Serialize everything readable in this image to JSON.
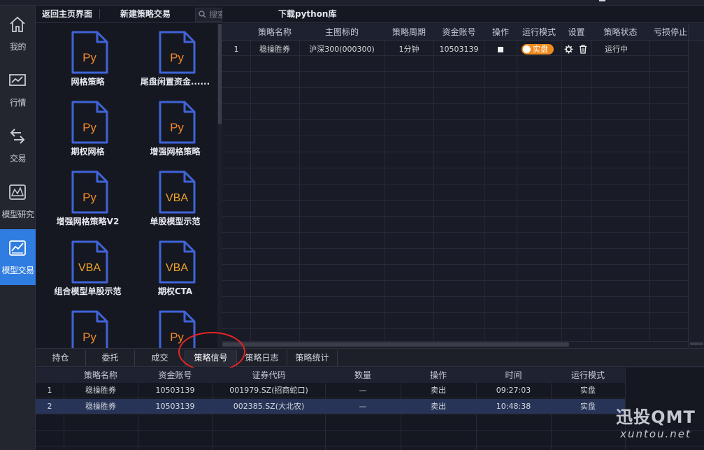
{
  "nav": {
    "items": [
      {
        "label": "我的",
        "icon": "home-icon"
      },
      {
        "label": "行情",
        "icon": "chart-icon"
      },
      {
        "label": "交易",
        "icon": "swap-icon"
      },
      {
        "label": "模型研究",
        "icon": "model-research-icon"
      },
      {
        "label": "模型交易",
        "icon": "model-trade-icon",
        "active": true
      }
    ]
  },
  "left_panel": {
    "back_label": "返回主页界面",
    "new_label": "新建策略交易",
    "search_placeholder": "搜索策略",
    "strategies": [
      {
        "name": "网格策略",
        "type": "Py"
      },
      {
        "name": "尾盘闲置资金......",
        "type": "Py"
      },
      {
        "name": "期权网格",
        "type": "Py"
      },
      {
        "name": "增强网格策略",
        "type": "Py"
      },
      {
        "name": "增强网格策略V2",
        "type": "Py"
      },
      {
        "name": "单股模型示范",
        "type": "VBA"
      },
      {
        "name": "组合模型单股示范",
        "type": "VBA"
      },
      {
        "name": "期权CTA",
        "type": "VBA"
      },
      {
        "name": "",
        "type": "Py"
      },
      {
        "name": "",
        "type": "Py"
      }
    ]
  },
  "python_tab": {
    "label": "下载python库"
  },
  "main_table": {
    "columns": [
      "",
      "策略名称",
      "主图标的",
      "策略周期",
      "资金账号",
      "操作",
      "运行模式",
      "设置",
      "策略状态",
      "亏损停止"
    ],
    "rows": [
      {
        "index": "1",
        "name": "稳操胜券",
        "symbol": "沪深300(000300)",
        "period": "1分钟",
        "account": "10503139",
        "mode": "实盘",
        "status": "运行中"
      }
    ]
  },
  "bottom_tabs": {
    "items": [
      "持仓",
      "委托",
      "成交",
      "策略信号",
      "策略日志",
      "策略统计"
    ],
    "active_index": 3
  },
  "signal_table": {
    "columns": [
      "",
      "策略名称",
      "资金账号",
      "证券代码",
      "数量",
      "操作",
      "时间",
      "运行模式"
    ],
    "rows": [
      {
        "index": "1",
        "name": "稳操胜券",
        "account": "10503139",
        "code": "001979.SZ(招商蛇口)",
        "qty": "—",
        "action": "卖出",
        "time": "09:27:03",
        "mode": "实盘"
      },
      {
        "index": "2",
        "name": "稳操胜券",
        "account": "10503139",
        "code": "002385.SZ(大北农)",
        "qty": "—",
        "action": "卖出",
        "time": "10:48:38",
        "mode": "实盘"
      }
    ]
  },
  "watermark": {
    "title": "迅投QMT",
    "url": "xuntou.net"
  },
  "colors": {
    "accent": "#2f7de1",
    "toggle": "#f08a1d",
    "running": "#2fbf52",
    "doc_outline": "#3f63d8",
    "py_text": "#f0892a",
    "vba_text": "#f0a42a",
    "highlight_ring": "#e52424"
  }
}
